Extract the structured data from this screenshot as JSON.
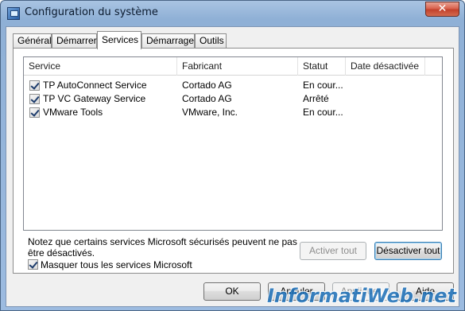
{
  "window": {
    "title": "Configuration du système",
    "close_label": "✕"
  },
  "tabs": [
    {
      "label": "Général"
    },
    {
      "label": "Démarrer"
    },
    {
      "label": "Services",
      "active": true
    },
    {
      "label": "Démarrage"
    },
    {
      "label": "Outils"
    }
  ],
  "services": {
    "columns": [
      "Service",
      "Fabricant",
      "Statut",
      "Date désactivée"
    ],
    "rows": [
      {
        "service": "TP AutoConnect Service",
        "fabricant": "Cortado AG",
        "statut": "En cour...",
        "date": "",
        "checked": true
      },
      {
        "service": "TP VC Gateway Service",
        "fabricant": "Cortado AG",
        "statut": "Arrêté",
        "date": "",
        "checked": true
      },
      {
        "service": "VMware Tools",
        "fabricant": "VMware, Inc.",
        "statut": "En cour...",
        "date": "",
        "checked": true
      }
    ]
  },
  "note": "Notez que certains services Microsoft sécurisés peuvent ne pas être désactivés.",
  "hide_ms": {
    "label": "Masquer tous les services Microsoft",
    "checked": true
  },
  "buttons": {
    "enable_all": "Activer tout",
    "disable_all": "Désactiver tout",
    "ok": "OK",
    "cancel": "Annuler",
    "apply": "Appliquer",
    "help": "Aide"
  },
  "watermark": "InformatiWeb.net",
  "colors": {
    "accent": "#1b6fb8",
    "title_bar": "#9cbbe0",
    "close_button": "#c2412b"
  }
}
